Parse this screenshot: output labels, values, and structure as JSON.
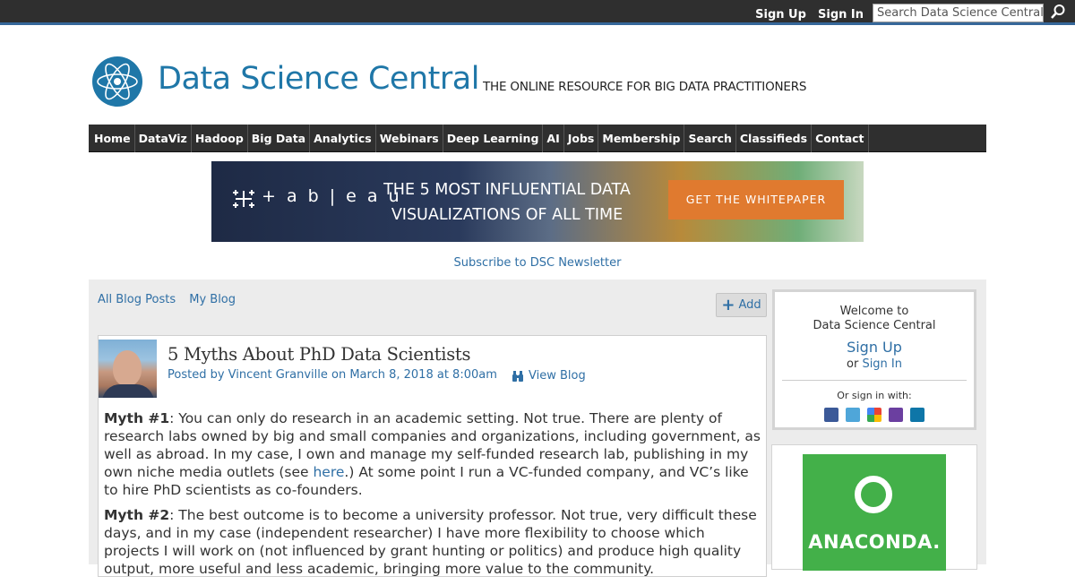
{
  "topbar": {
    "signup_label": "Sign Up",
    "signin_label": "Sign In",
    "search_placeholder": "Search Data Science Central"
  },
  "header": {
    "site_name": "Data Science Central",
    "tagline": "THE ONLINE RESOURCE FOR BIG DATA PRACTITIONERS"
  },
  "nav": {
    "items": [
      "Home",
      "DataViz",
      "Hadoop",
      "Big Data",
      "Analytics",
      "Webinars",
      "Deep Learning",
      "AI",
      "Jobs",
      "Membership",
      "Search",
      "Classifieds",
      "Contact"
    ]
  },
  "banner": {
    "brand": "+ a b | e a u",
    "headline": "THE 5 MOST INFLUENTIAL DATA VISUALIZATIONS OF ALL TIME",
    "cta": "GET THE WHITEPAPER"
  },
  "subscribe_label": "Subscribe to DSC Newsletter",
  "blog_nav": {
    "all_posts": "All Blog Posts",
    "my_blog": "My Blog",
    "add": "Add"
  },
  "post": {
    "title": "5 Myths About PhD Data Scientists",
    "meta": "Posted by Vincent Granville on March 8, 2018 at 8:00am",
    "view_blog": "View Blog",
    "myth1_label": "Myth #1",
    "myth1_text_a": ": You can only do research in an academic setting. Not true. There are plenty of research labs owned by big and small companies and organizations, including government, as well as abroad. In my case, I own and manage my self-funded research lab, publishing in my own niche media outlets (see ",
    "myth1_link": "here",
    "myth1_text_b": ".) At some point I run a VC-funded company, and VC’s like to hire PhD scientists as co-founders.",
    "myth2_label": "Myth #2",
    "myth2_text": ": The best outcome is to become a university professor. Not true, very difficult these days, and in my case (independent researcher) I have more flexibility to choose which projects I will work on (not influenced by grant hunting or politics) and produce high quality output, more useful and less academic, bringing more value to the community."
  },
  "sidebar": {
    "welcome_line1": "Welcome to",
    "welcome_line2": "Data Science Central",
    "signup": "Sign Up",
    "or": "or",
    "signin": "Sign In",
    "or_sign_in_with": "Or sign in with:",
    "social_icons": [
      "facebook-icon",
      "twitter-icon",
      "google-icon",
      "yahoo-icon",
      "linkedin-icon"
    ],
    "ad_brand": "ANACONDA."
  },
  "colors": {
    "link": "#2f6fa5",
    "topbar": "#2f2f2f",
    "cta": "#e07a2f",
    "anaconda_green": "#43b049"
  }
}
